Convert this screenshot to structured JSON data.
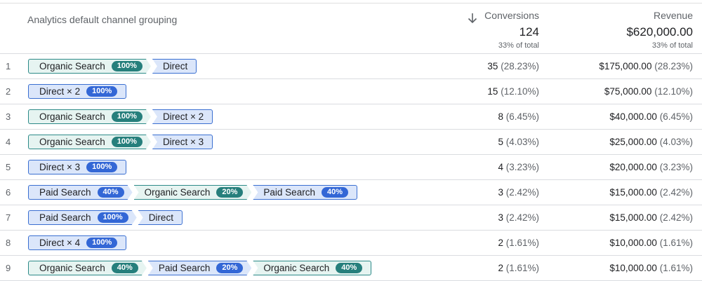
{
  "header": {
    "dimension_label": "Analytics default channel grouping",
    "conversions": {
      "label": "Conversions",
      "total": "124",
      "pct_of_total": "33% of total"
    },
    "revenue": {
      "label": "Revenue",
      "total": "$620,000.00",
      "pct_of_total": "33% of total"
    }
  },
  "icons": {
    "sort": "arrow-down-icon"
  },
  "colors": {
    "organic_bg": "#e6f4f1",
    "organic_border": "#2c8a88",
    "blue_bg": "#dbe6fa",
    "blue_border": "#3a6fd1"
  },
  "rows": [
    {
      "num": "1",
      "path": [
        {
          "label": "Organic Search",
          "badge": "100%",
          "type": "organic"
        },
        {
          "label": "Direct",
          "type": "direct"
        }
      ],
      "conv": "35",
      "conv_pct": "(28.23%)",
      "rev": "$175,000.00",
      "rev_pct": "(28.23%)"
    },
    {
      "num": "2",
      "path": [
        {
          "label": "Direct × 2",
          "badge": "100%",
          "type": "direct"
        }
      ],
      "conv": "15",
      "conv_pct": "(12.10%)",
      "rev": "$75,000.00",
      "rev_pct": "(12.10%)"
    },
    {
      "num": "3",
      "path": [
        {
          "label": "Organic Search",
          "badge": "100%",
          "type": "organic"
        },
        {
          "label": "Direct × 2",
          "type": "direct"
        }
      ],
      "conv": "8",
      "conv_pct": "(6.45%)",
      "rev": "$40,000.00",
      "rev_pct": "(6.45%)"
    },
    {
      "num": "4",
      "path": [
        {
          "label": "Organic Search",
          "badge": "100%",
          "type": "organic"
        },
        {
          "label": "Direct × 3",
          "type": "direct"
        }
      ],
      "conv": "5",
      "conv_pct": "(4.03%)",
      "rev": "$25,000.00",
      "rev_pct": "(4.03%)"
    },
    {
      "num": "5",
      "path": [
        {
          "label": "Direct × 3",
          "badge": "100%",
          "type": "direct"
        }
      ],
      "conv": "4",
      "conv_pct": "(3.23%)",
      "rev": "$20,000.00",
      "rev_pct": "(3.23%)"
    },
    {
      "num": "6",
      "path": [
        {
          "label": "Paid Search",
          "badge": "40%",
          "type": "paid"
        },
        {
          "label": "Organic Search",
          "badge": "20%",
          "type": "organic"
        },
        {
          "label": "Paid Search",
          "badge": "40%",
          "type": "paid"
        }
      ],
      "conv": "3",
      "conv_pct": "(2.42%)",
      "rev": "$15,000.00",
      "rev_pct": "(2.42%)"
    },
    {
      "num": "7",
      "path": [
        {
          "label": "Paid Search",
          "badge": "100%",
          "type": "paid"
        },
        {
          "label": "Direct",
          "type": "direct"
        }
      ],
      "conv": "3",
      "conv_pct": "(2.42%)",
      "rev": "$15,000.00",
      "rev_pct": "(2.42%)"
    },
    {
      "num": "8",
      "path": [
        {
          "label": "Direct × 4",
          "badge": "100%",
          "type": "direct"
        }
      ],
      "conv": "2",
      "conv_pct": "(1.61%)",
      "rev": "$10,000.00",
      "rev_pct": "(1.61%)"
    },
    {
      "num": "9",
      "path": [
        {
          "label": "Organic Search",
          "badge": "40%",
          "type": "organic"
        },
        {
          "label": "Paid Search",
          "badge": "20%",
          "type": "paid"
        },
        {
          "label": "Organic Search",
          "badge": "40%",
          "type": "organic"
        }
      ],
      "conv": "2",
      "conv_pct": "(1.61%)",
      "rev": "$10,000.00",
      "rev_pct": "(1.61%)"
    }
  ]
}
